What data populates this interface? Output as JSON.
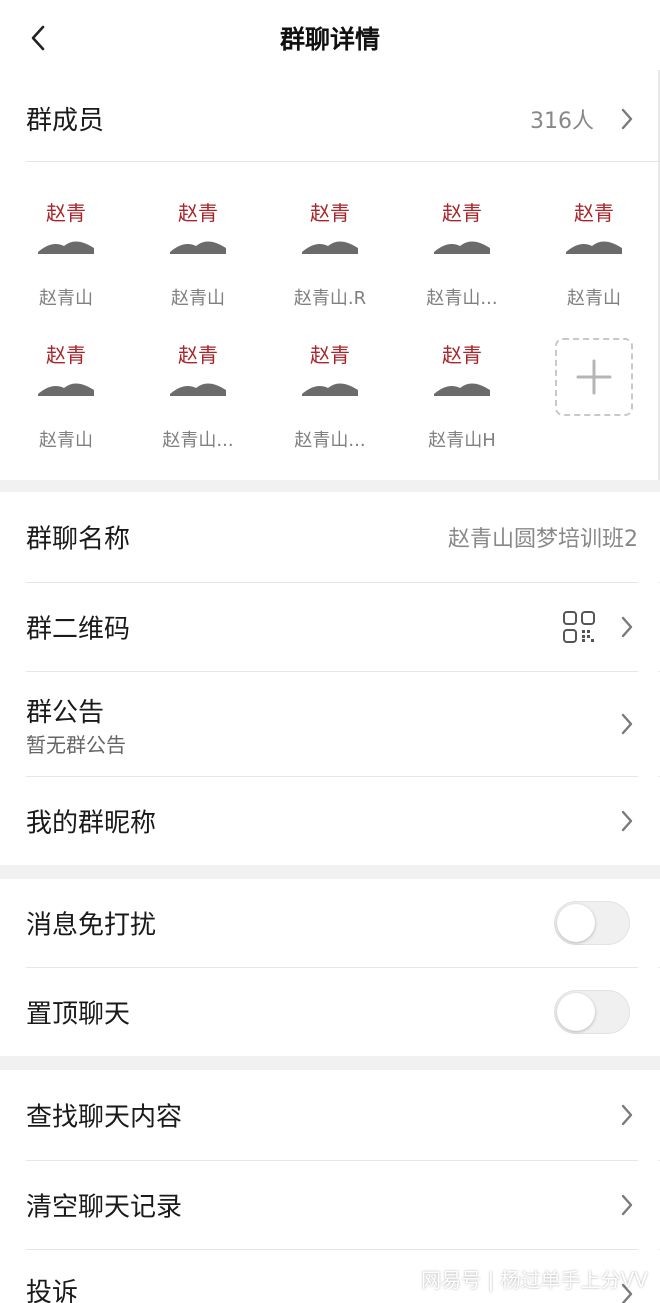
{
  "header": {
    "title": "群聊详情"
  },
  "members": {
    "label": "群成员",
    "count": "316人",
    "list": [
      {
        "name": "赵青山"
      },
      {
        "name": "赵青山"
      },
      {
        "name": "赵青山.R"
      },
      {
        "name": "赵青山..."
      },
      {
        "name": "赵青山"
      },
      {
        "name": "赵青山"
      },
      {
        "name": "赵青山..."
      },
      {
        "name": "赵青山..."
      },
      {
        "name": "赵青山H"
      }
    ],
    "avatar_text": "赵青",
    "add_icon": "plus-icon"
  },
  "settings": {
    "group_name_label": "群聊名称",
    "group_name_value": "赵青山圆梦培训班2",
    "qr_label": "群二维码",
    "announcement_label": "群公告",
    "announcement_value": "暂无群公告",
    "nickname_label": "我的群昵称",
    "mute_label": "消息免打扰",
    "pin_label": "置顶聊天",
    "search_label": "查找聊天内容",
    "clear_label": "清空聊天记录",
    "report_label": "投诉"
  },
  "toggles": {
    "mute": false,
    "pin": false
  },
  "watermark": "网易号 | 杨过单手上分VV",
  "colors": {
    "avatar_red": "#a8262b",
    "chevron": "#7a7a7a",
    "section_gap": "#f1f1f1"
  }
}
